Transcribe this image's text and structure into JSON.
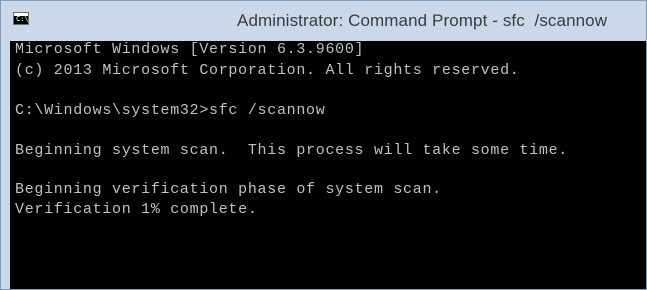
{
  "window": {
    "title": "Administrator: Command Prompt - sfc  /scannow",
    "icon": "command-prompt-icon",
    "icon_glyph": "C:\\"
  },
  "console": {
    "lines": [
      "Microsoft Windows [Version 6.3.9600]",
      "(c) 2013 Microsoft Corporation. All rights reserved.",
      "",
      "C:\\Windows\\system32>sfc /scannow",
      "",
      "Beginning system scan.  This process will take some time.",
      "",
      "Beginning verification phase of system scan.",
      "Verification 1% complete."
    ],
    "text_color": "#c0c0c0",
    "background_color": "#000000"
  }
}
